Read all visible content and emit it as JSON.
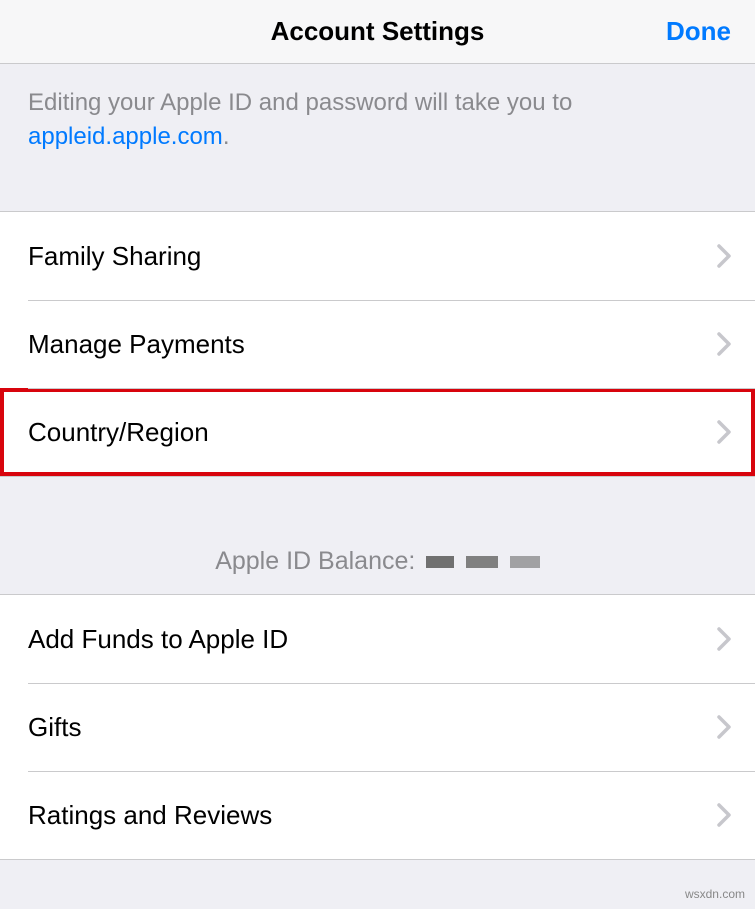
{
  "header": {
    "title": "Account Settings",
    "done_label": "Done"
  },
  "info": {
    "prefix": "Editing your Apple ID and password will take you to ",
    "link_text": "appleid.apple.com",
    "suffix": "."
  },
  "group1": {
    "items": [
      {
        "label": "Family Sharing"
      },
      {
        "label": "Manage Payments"
      },
      {
        "label": "Country/Region"
      }
    ]
  },
  "balance": {
    "label": "Apple ID Balance:"
  },
  "group2": {
    "items": [
      {
        "label": "Add Funds to Apple ID"
      },
      {
        "label": "Gifts"
      },
      {
        "label": "Ratings and Reviews"
      }
    ]
  },
  "watermark": "wsxdn.com"
}
